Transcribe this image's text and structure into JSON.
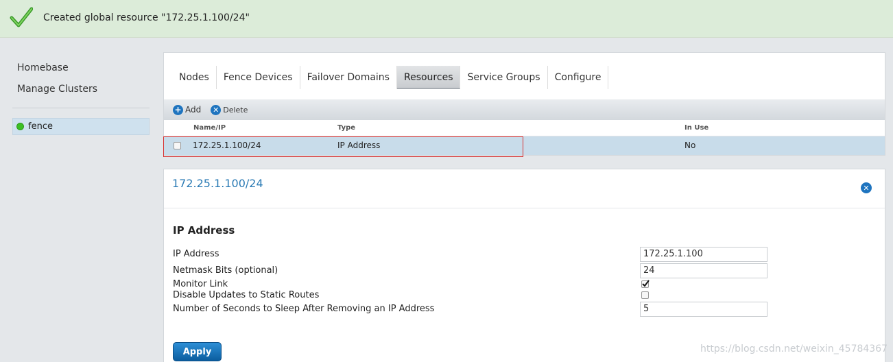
{
  "banner": {
    "message": "Created global resource \"172.25.1.100/24\""
  },
  "sidebar": {
    "links": [
      {
        "label": "Homebase"
      },
      {
        "label": "Manage Clusters"
      }
    ],
    "clusters": [
      {
        "label": "fence",
        "status_color": "#3bbf24"
      }
    ]
  },
  "tabs": [
    {
      "label": "Nodes"
    },
    {
      "label": "Fence Devices"
    },
    {
      "label": "Failover Domains"
    },
    {
      "label": "Resources"
    },
    {
      "label": "Service Groups"
    },
    {
      "label": "Configure"
    }
  ],
  "toolbar": {
    "add_label": "Add",
    "delete_label": "Delete"
  },
  "grid": {
    "columns": [
      "Name/IP",
      "Type",
      "In Use"
    ],
    "rows": [
      {
        "name": "172.25.1.100/24",
        "type": "IP Address",
        "in_use": "No"
      }
    ]
  },
  "detail": {
    "title": "172.25.1.100/24",
    "section": "IP Address",
    "fields": [
      {
        "label": "IP Address",
        "value": "172.25.1.100"
      },
      {
        "label": "Netmask Bits (optional)",
        "value": "24"
      },
      {
        "label": "Monitor Link",
        "checked": true
      },
      {
        "label": "Disable Updates to Static Routes",
        "checked": false
      },
      {
        "label": "Number of Seconds to Sleep After Removing an IP Address",
        "value": "5"
      }
    ],
    "apply_label": "Apply"
  },
  "watermark": "https://blog.csdn.net/weixin_45784367",
  "colors": {
    "accent": "#1e74bf",
    "title": "#2a7ab4",
    "banner": "#dcecd9",
    "selected_row": "#c8dcea",
    "highlight_box": "#d83232"
  }
}
